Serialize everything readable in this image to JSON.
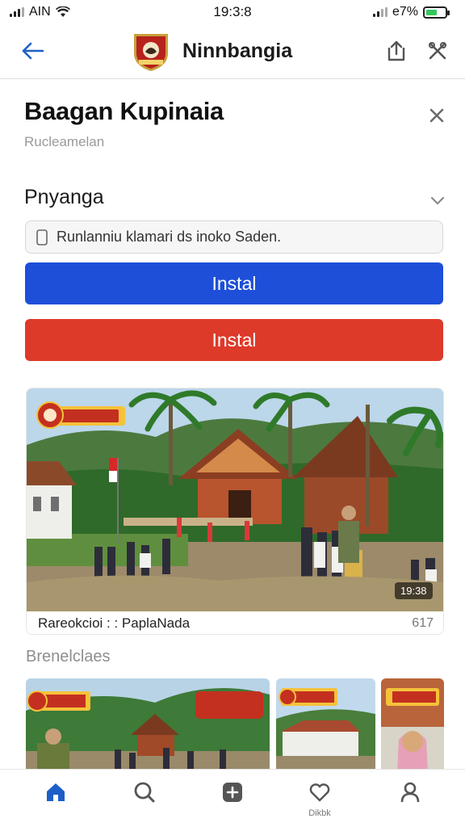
{
  "status_bar": {
    "carrier": "AIN",
    "time": "19:3:8",
    "battery": "e7%"
  },
  "app_bar": {
    "brand_name": "Ninnbangia"
  },
  "header": {
    "title": "Baagan Kupinaia",
    "subtitle": "Rucleamelan"
  },
  "section": {
    "title": "Pnyanga"
  },
  "search": {
    "value": "Runlanniu klamari ds inoko Saden."
  },
  "buttons": {
    "primary_label": "Instal",
    "secondary_label": "Instal"
  },
  "feature": {
    "caption": "Rareokcioi : : PaplaNada",
    "count": "617",
    "duration": "19:38"
  },
  "related": {
    "title": "Brenelclaes"
  },
  "bottom_nav": {
    "profile_label": "Dikbk"
  },
  "colors": {
    "primary_button": "#1d4fd8",
    "secondary_button": "#dd3a2a",
    "accent_icon": "#1d5fc7"
  },
  "icons": [
    "signal-icon",
    "wifi-icon",
    "battery-icon",
    "back-arrow-icon",
    "logo-emblem",
    "share-icon",
    "tools-icon",
    "close-icon",
    "chevron-down-icon",
    "document-icon",
    "home-icon",
    "search-icon",
    "add-icon",
    "heart-icon",
    "profile-icon"
  ]
}
